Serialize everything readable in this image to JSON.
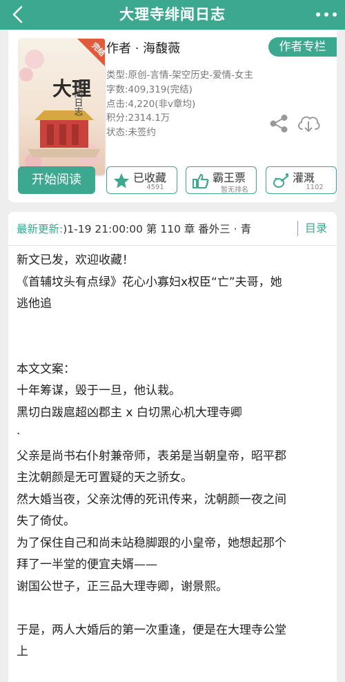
{
  "header": {
    "title": "大理寺绯闻日志"
  },
  "book": {
    "cover_badge": "完结",
    "cover_title": "大理寺绯闻日志",
    "author": "作者 · 海馥薇",
    "author_button": "作者专栏",
    "meta": [
      "类型:原创-言情-架空历史-爱情-女主",
      "字数:409,319(完结)",
      "点击:4,220(非v章均)",
      "积分:2314.1万",
      "状态:未签约"
    ]
  },
  "actions": {
    "start": "开始阅读",
    "favorite": {
      "label": "已收藏",
      "count": "4591"
    },
    "rank": {
      "label": "霸王票",
      "count": "暂无排名"
    },
    "water": {
      "label": "灌溉",
      "count": "1102"
    }
  },
  "update": {
    "label": "最新更新:",
    "text": ")1-19 21:00:00  第 110 章 番外三 · 青",
    "toc": "目录"
  },
  "body_lines": [
    "新文已发，欢迎收藏！",
    "《首辅坟头有点绿》花心小寡妇x权臣“亡”夫哥，她",
    "逃他追",
    "",
    "",
    "本文文案：",
    "十年筹谋，毁于一旦，他认栽。",
    "黑切白跋扈超凶郡主 x 白切黑心机大理寺卿",
    "·",
    "父亲是尚书右仆射兼帝师，表弟是当朝皇帝，昭平郡",
    "主沈朝颜是无可置疑的天之骄女。",
    "然大婚当夜，父亲沈傅的死讯传来，沈朝颜一夜之间",
    "失了倚仗。",
    "为了保住自己和尚未站稳脚跟的小皇帝，她想起那个",
    "拜了一半堂的便宜夫婿——",
    "谢国公世子，正三品大理寺卿，谢景熙。",
    "",
    "于是，两人大婚后的第一次重逢，便是在大理寺公堂",
    "上"
  ],
  "colors": {
    "accent": "#3ba88f",
    "background": "#eeeeee",
    "cover_badge": "#e25a3c"
  },
  "icons": {
    "back": "chevron-left-icon",
    "more": "more-dots-icon",
    "share": "share-icon",
    "download": "cloud-download-icon",
    "favorite": "star-icon",
    "rank": "thumbs-up-icon",
    "water": "watering-can-icon"
  }
}
